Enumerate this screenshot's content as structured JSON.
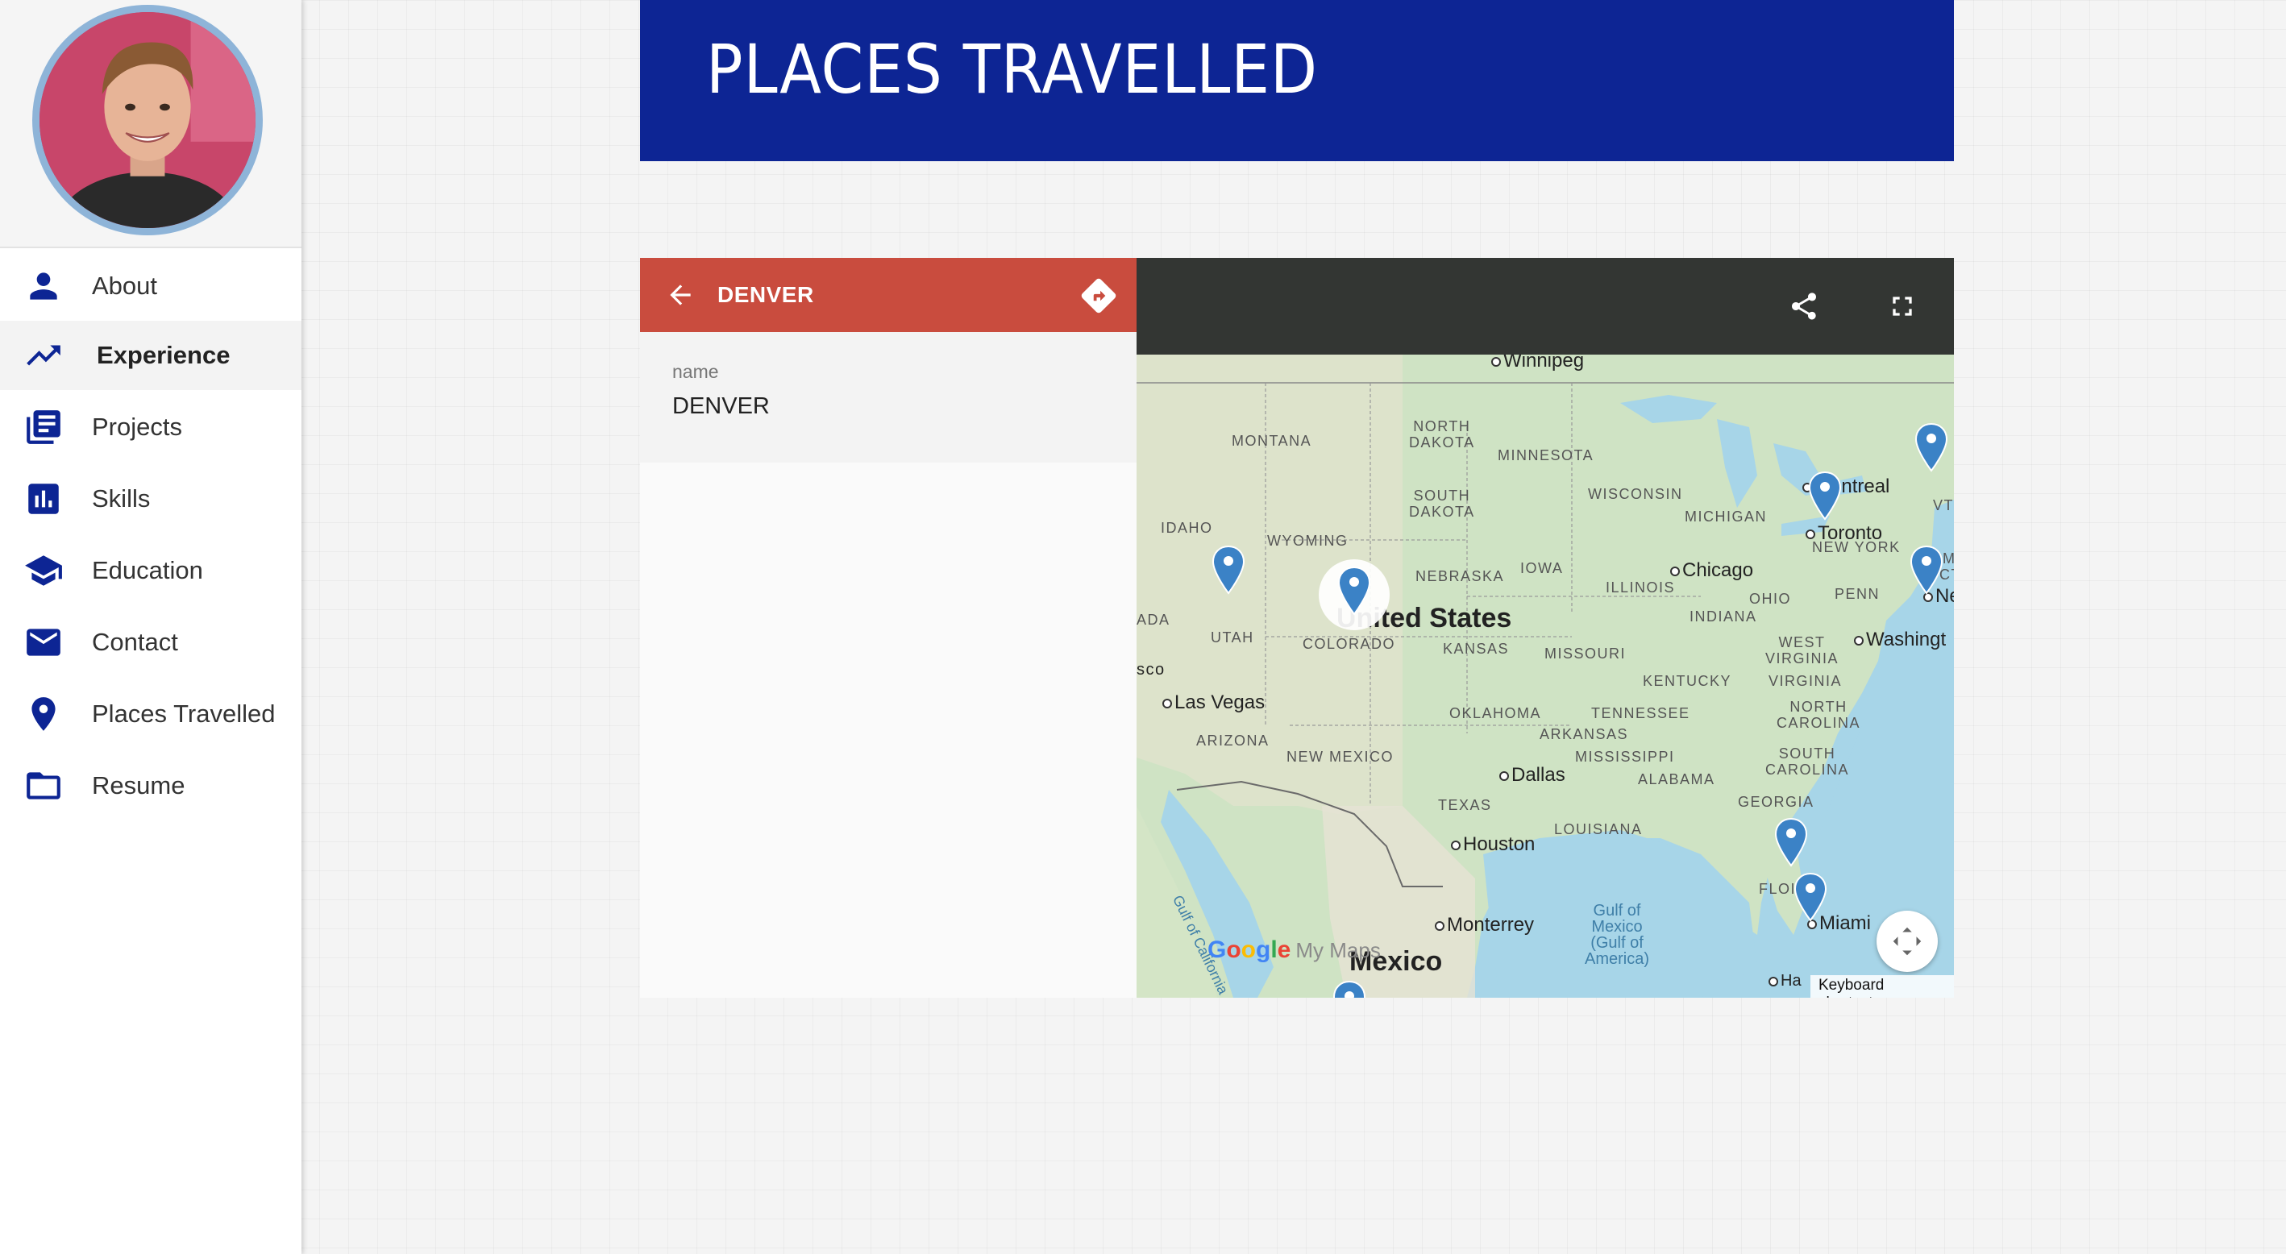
{
  "sidebar": {
    "items": [
      {
        "label": "About",
        "icon": "person-icon"
      },
      {
        "label": "Experience",
        "icon": "trending-up-icon",
        "active": true
      },
      {
        "label": "Projects",
        "icon": "library-books-icon"
      },
      {
        "label": "Skills",
        "icon": "bar-chart-icon"
      },
      {
        "label": "Education",
        "icon": "graduation-cap-icon"
      },
      {
        "label": "Contact",
        "icon": "mail-icon"
      },
      {
        "label": "Places Travelled",
        "icon": "location-pin-icon"
      },
      {
        "label": "Resume",
        "icon": "folder-icon"
      }
    ]
  },
  "header": {
    "title": "PLACES TRAVELLED"
  },
  "map_widget": {
    "info_panel": {
      "title": "DENVER",
      "field_label": "name",
      "field_value": "DENVER"
    },
    "map": {
      "country_labels": {
        "us": "United States",
        "mexico": "Mexico"
      },
      "state_labels": {
        "montana": "MONTANA",
        "north_dakota": "NORTH\nDAKOTA",
        "minnesota": "MINNESOTA",
        "south_dakota": "SOUTH\nDAKOTA",
        "wisconsin": "WISCONSIN",
        "michigan": "MICHIGAN",
        "idaho": "IDAHO",
        "wyoming": "WYOMING",
        "iowa": "IOWA",
        "nebraska": "NEBRASKA",
        "illinois": "ILLINOIS",
        "ohio": "OHIO",
        "penn": "PENN",
        "indiana": "INDIANA",
        "utah": "UTAH",
        "colorado": "COLORADO",
        "kansas": "KANSAS",
        "missouri": "MISSOURI",
        "west_virginia": "WEST\nVIRGINIA",
        "virginia": "VIRGINIA",
        "kentucky": "KENTUCKY",
        "tennessee": "TENNESSEE",
        "north_carolina": "NORTH\nCAROLINA",
        "oklahoma": "OKLAHOMA",
        "arizona": "ARIZONA",
        "new_mexico": "NEW MEXICO",
        "arkansas": "ARKANSAS",
        "mississippi": "MISSISSIPPI",
        "south_carolina": "SOUTH\nCAROLINA",
        "alabama": "ALABAMA",
        "georgia": "GEORGIA",
        "texas": "TEXAS",
        "louisiana": "LOUISIANA",
        "new_york": "NEW YORK",
        "nevada_partial": "ADA",
        "vt_partial": "VT",
        "ma_partial": "M",
        "ct_partial": "CT",
        "florida_partial": "FLOI",
        "sf_partial": "sco"
      },
      "city_labels": {
        "winnipeg": "Winnipeg",
        "montreal": "Montreal",
        "toronto": "Toronto",
        "chicago": "Chicago",
        "las_vegas": "Las Vegas",
        "dallas": "Dallas",
        "houston": "Houston",
        "monterrey": "Monterrey",
        "miami": "Miami",
        "washington": "Washingt",
        "new_york_partial": "Ne",
        "havana_partial": "Ha"
      },
      "water_labels": {
        "gulf": "Gulf of\nMexico\n(Gulf of\nAmerica)",
        "gulf_california": "Gulf of California"
      },
      "attribution": {
        "google": "Google",
        "mymaps": "My Maps"
      },
      "keyboard_shortcuts": "Keyboard shortcuts"
    }
  },
  "colors": {
    "brand": "#0d2594",
    "info_bar": "#c94c3e",
    "map_toolbar": "#333633",
    "pin": "#3b82c6"
  }
}
